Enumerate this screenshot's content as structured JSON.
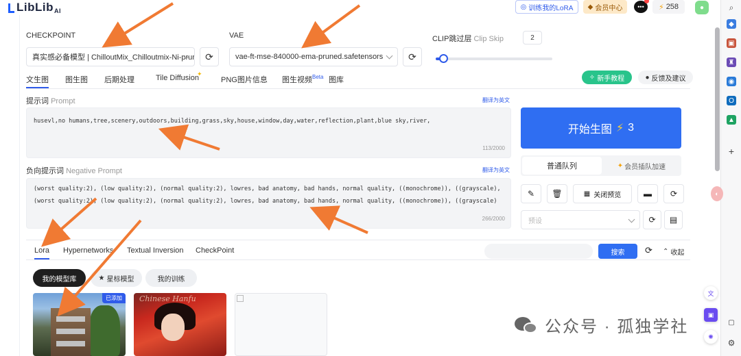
{
  "topbar": {
    "logo_text": "LibLib",
    "logo_suffix": "AI",
    "train_lora_label": "训练我的LoRA",
    "member_label": "会员中心",
    "credits": "258"
  },
  "checkpoint": {
    "label": "CHECKPOINT",
    "value": "真实感必备模型 | ChilloutMix_Chilloutmix-Ni-prun"
  },
  "vae": {
    "label": "VAE",
    "value": "vae-ft-mse-840000-ema-pruned.safetensors"
  },
  "clip_skip": {
    "label_cn": "CLIP跳过层",
    "label_en": "Clip Skip",
    "value": "2",
    "slider_fraction": 0.06
  },
  "tabs": [
    {
      "label": "文生图"
    },
    {
      "label": "图生图"
    },
    {
      "label": "后期处理"
    },
    {
      "label": "Tile Diffusion"
    },
    {
      "label": "PNG图片信息"
    },
    {
      "label": "图生视频"
    },
    {
      "label": "图库"
    }
  ],
  "beta_label": "Beta",
  "tutorial_label": "新手教程",
  "feedback_label": "反馈及建议",
  "prompt": {
    "label_cn": "提示词",
    "label_en": "Prompt",
    "translate": "翻译为英文",
    "text": "husevl,no humans,tree,scenery,outdoors,building,grass,sky,house,window,day,water,reflection,plant,blue sky,river,",
    "counter": "113/2000"
  },
  "negative": {
    "label_cn": "负向提示词",
    "label_en": "Negative Prompt",
    "translate": "翻译为英文",
    "line1": "(worst quality:2), (low quality:2), (normal quality:2), lowres, bad anatomy, bad hands, normal quality, ((monochrome)), ((grayscale),",
    "line2": "(worst quality:2), (low quality:2), (normal quality:2), lowres, bad anatomy, bad hands, normal quality, ((monochrome)), ((grayscale)",
    "counter": "266/2000"
  },
  "generate": {
    "label": "开始生图",
    "cost": "3"
  },
  "queue": {
    "normal": "普通队列",
    "vip": "会员插队加速"
  },
  "close_preview_label": "关闭预览",
  "preset_placeholder": "预设",
  "model_tabs": [
    {
      "label": "Lora"
    },
    {
      "label": "Hypernetworks"
    },
    {
      "label": "Textual Inversion"
    },
    {
      "label": "CheckPoint"
    }
  ],
  "search_label": "搜索",
  "collapse_label": "收起",
  "filters": [
    {
      "label": "我的模型库"
    },
    {
      "label": "星标模型"
    },
    {
      "label": "我的训练"
    }
  ],
  "cards": {
    "added_tag": "已添加",
    "card2_text": "Chinese Hanfu"
  },
  "watermark": "公众号 · 孤独学社",
  "colors": {
    "accent": "#2f5bea",
    "generate": "#2f6ef2",
    "tutorial": "#29c48b",
    "arrow": "#f07a33"
  }
}
